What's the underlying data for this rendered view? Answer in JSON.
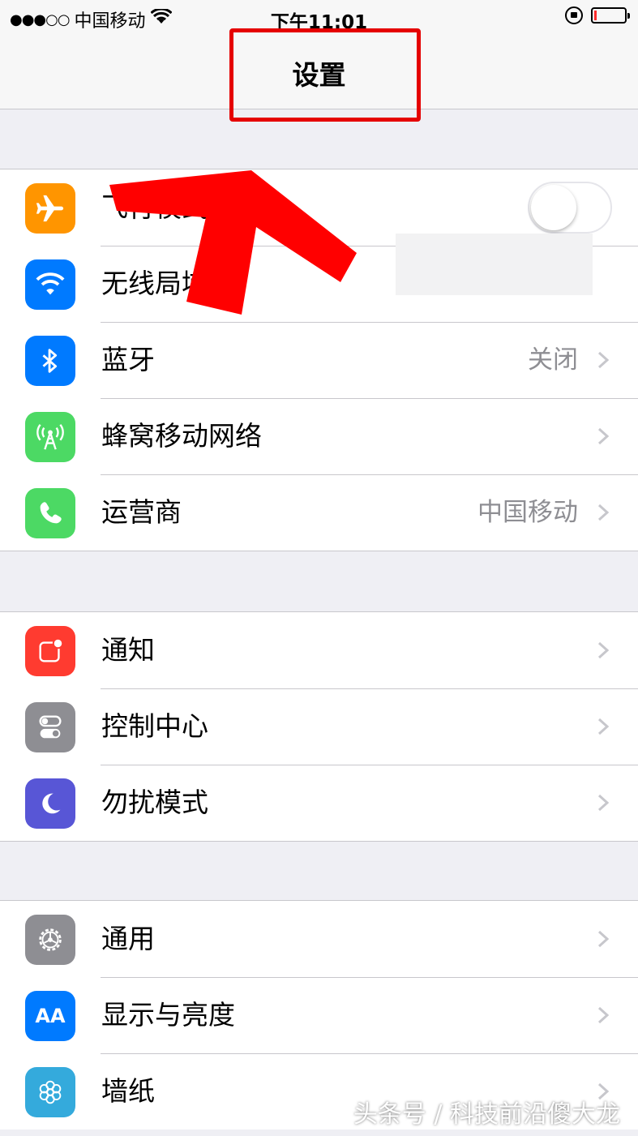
{
  "status_bar": {
    "signal_dots": "●●●○○",
    "carrier": "中国移动",
    "time": "下午11:01"
  },
  "nav": {
    "title": "设置"
  },
  "groups": [
    {
      "rows": [
        {
          "label": "飞行模式",
          "icon": "airplane-icon",
          "color": "#ff9500",
          "toggle": false
        },
        {
          "label": "无线局域网",
          "icon": "wifi-icon",
          "color": "#007aff",
          "value": ""
        },
        {
          "label": "蓝牙",
          "icon": "bluetooth-icon",
          "color": "#007aff",
          "value": "关闭"
        },
        {
          "label": "蜂窝移动网络",
          "icon": "cellular-icon",
          "color": "#4cd964",
          "value": ""
        },
        {
          "label": "运营商",
          "icon": "phone-icon",
          "color": "#4cd964",
          "value": "中国移动"
        }
      ]
    },
    {
      "rows": [
        {
          "label": "通知",
          "icon": "notifications-icon",
          "color": "#ff3b30"
        },
        {
          "label": "控制中心",
          "icon": "control-center-icon",
          "color": "#8e8e93"
        },
        {
          "label": "勿扰模式",
          "icon": "moon-icon",
          "color": "#5856d6"
        }
      ]
    },
    {
      "rows": [
        {
          "label": "通用",
          "icon": "gear-icon",
          "color": "#8e8e93"
        },
        {
          "label": "显示与亮度",
          "icon": "display-icon",
          "color": "#007aff",
          "icon_text": "AA"
        },
        {
          "label": "墙纸",
          "icon": "wallpaper-icon",
          "color": "#34aadc"
        }
      ]
    }
  ],
  "watermark": "头条号 / 科技前沿傻大龙",
  "annotation_color": "#e50000"
}
